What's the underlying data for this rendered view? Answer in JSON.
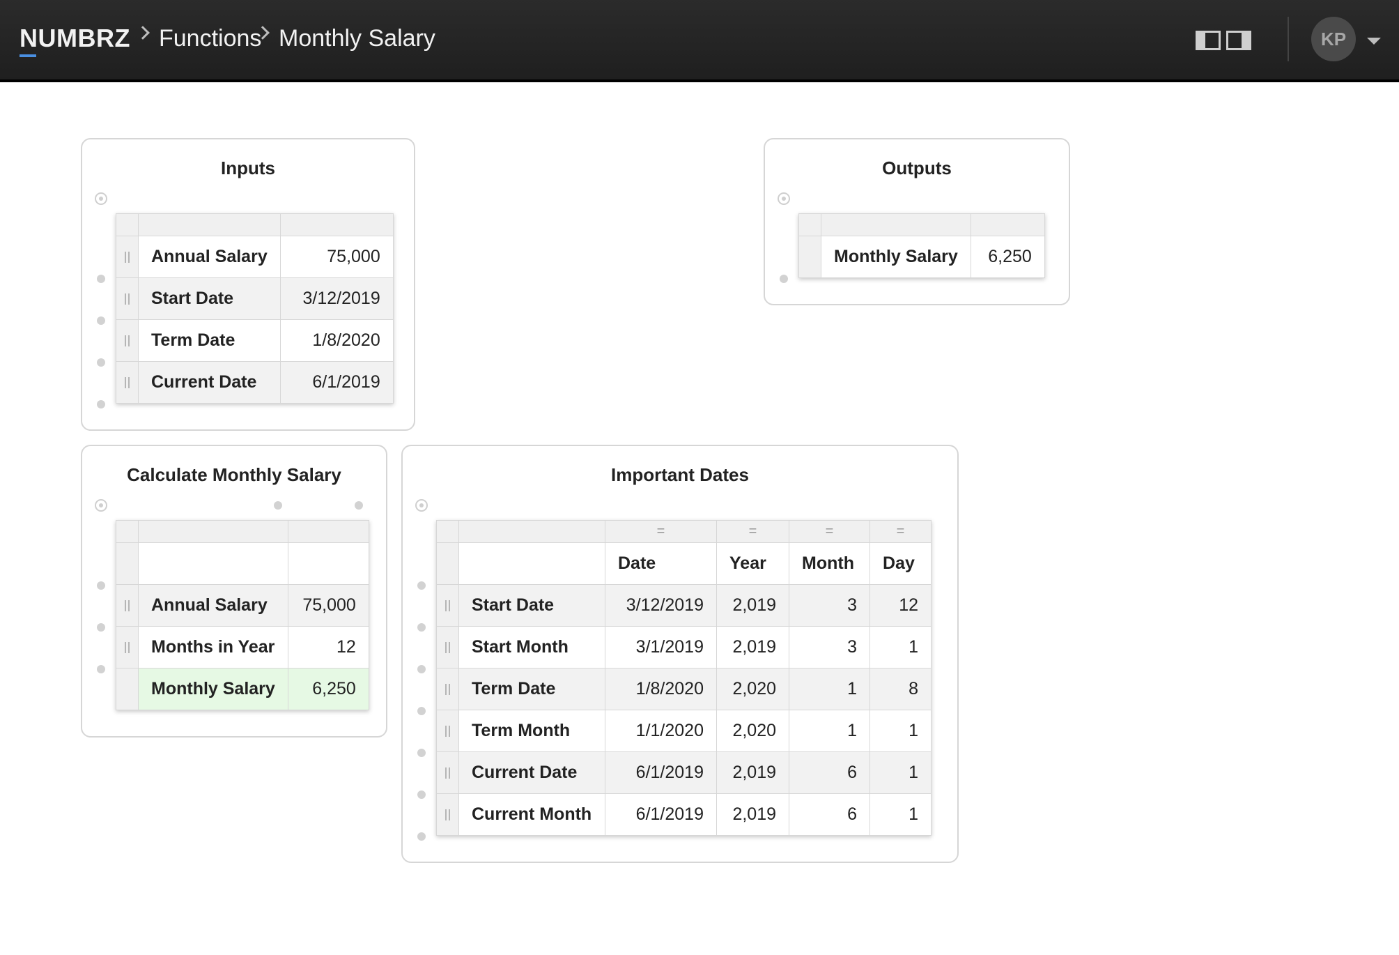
{
  "header": {
    "brand": "NUMBRZ",
    "breadcrumbs": [
      "Functions",
      "Monthly Salary"
    ],
    "avatar_initials": "KP",
    "accent_color": "#4a90e2"
  },
  "inputs": {
    "title": "Inputs",
    "rows": [
      {
        "label": "Annual Salary",
        "value": "75,000"
      },
      {
        "label": "Start Date",
        "value": "3/12/2019"
      },
      {
        "label": "Term Date",
        "value": "1/8/2020"
      },
      {
        "label": "Current Date",
        "value": "6/1/2019"
      }
    ]
  },
  "outputs": {
    "title": "Outputs",
    "rows": [
      {
        "label": "Monthly Salary",
        "value": "6,250"
      }
    ]
  },
  "calc": {
    "title": "Calculate Monthly Salary",
    "rows": [
      {
        "label": "Annual Salary",
        "value": "75,000"
      },
      {
        "label": "Months in Year",
        "value": "12"
      },
      {
        "label": "Monthly Salary",
        "value": "6,250"
      }
    ],
    "result_color": "#e6f9e4"
  },
  "dates": {
    "title": "Important Dates",
    "columns": [
      "Date",
      "Year",
      "Month",
      "Day"
    ],
    "column_marker": "=",
    "rows": [
      {
        "label": "Start Date",
        "date": "3/12/2019",
        "year": "2,019",
        "month": "3",
        "day": "12"
      },
      {
        "label": "Start Month",
        "date": "3/1/2019",
        "year": "2,019",
        "month": "3",
        "day": "1"
      },
      {
        "label": "Term Date",
        "date": "1/8/2020",
        "year": "2,020",
        "month": "1",
        "day": "8"
      },
      {
        "label": "Term Month",
        "date": "1/1/2020",
        "year": "2,020",
        "month": "1",
        "day": "1"
      },
      {
        "label": "Current Date",
        "date": "6/1/2019",
        "year": "2,019",
        "month": "6",
        "day": "1"
      },
      {
        "label": "Current Month",
        "date": "6/1/2019",
        "year": "2,019",
        "month": "6",
        "day": "1"
      }
    ]
  }
}
